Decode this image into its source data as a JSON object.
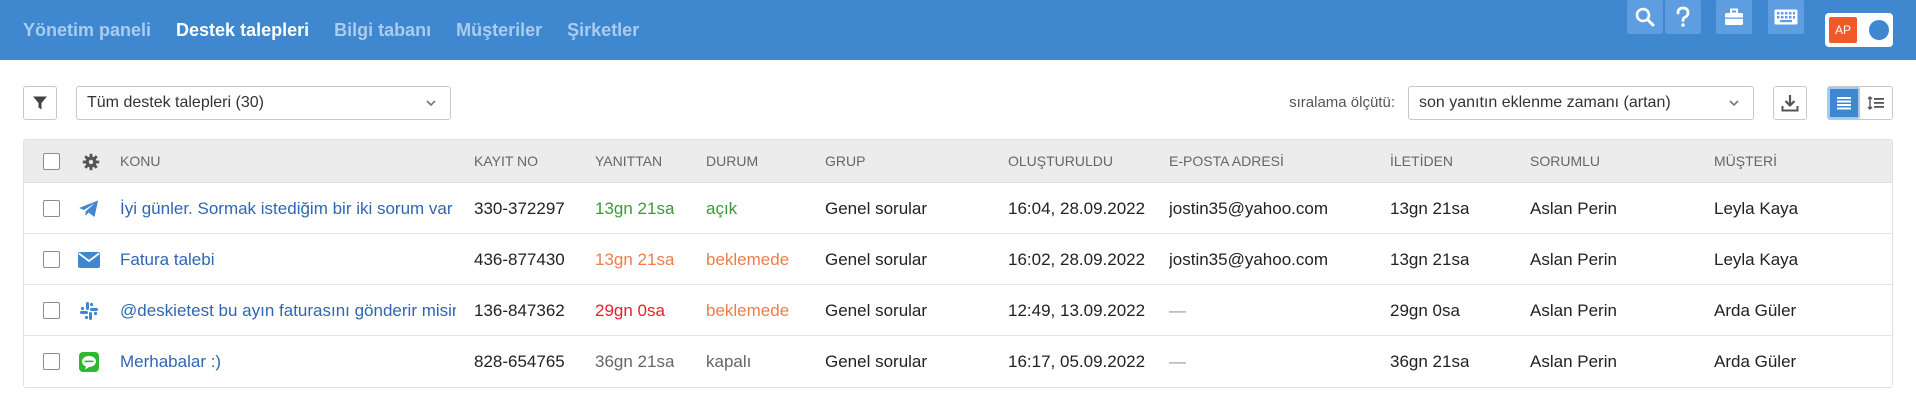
{
  "nav": {
    "items": [
      {
        "label": "Yönetim paneli",
        "active": false
      },
      {
        "label": "Destek talepleri",
        "active": true
      },
      {
        "label": "Bilgi tabanı",
        "active": false
      },
      {
        "label": "Müşteriler",
        "active": false
      },
      {
        "label": "Şirketler",
        "active": false
      }
    ]
  },
  "top_icons": [
    "search-icon",
    "help-icon",
    "briefcase-icon",
    "keyboard-icon"
  ],
  "user": {
    "initials": "AP"
  },
  "filter": {
    "selected": "Tüm destek talepleri (30)"
  },
  "sort": {
    "label": "sıralama ölçütü:",
    "selected": "son yanıtın eklenme zamanı (artan)"
  },
  "table": {
    "headers": {
      "subject": "KONU",
      "id": "KAYIT NO",
      "since_reply": "YANITTAN",
      "status": "DURUM",
      "group": "GRUP",
      "created": "OLUŞTURULDU",
      "email": "E-POSTA ADRESİ",
      "since_message": "İLETİDEN",
      "assignee": "SORUMLU",
      "customer": "MÜŞTERİ"
    },
    "rows": [
      {
        "channel": "telegram-icon",
        "subject": "İyi günler. Sormak istediğim bir iki sorum var",
        "id": "330-372297",
        "since_reply": "13gn 21sa",
        "status": "açık",
        "group": "Genel sorular",
        "created": "16:04, 28.09.2022",
        "email": "jostin35@yahoo.com",
        "since_message": "13gn 21sa",
        "assignee": "Aslan Perin",
        "customer": "Leyla Kaya"
      },
      {
        "channel": "email-icon",
        "subject": "Fatura talebi",
        "id": "436-877430",
        "since_reply": "13gn 21sa",
        "status": "beklemede",
        "group": "Genel sorular",
        "created": "16:02, 28.09.2022",
        "email": "jostin35@yahoo.com",
        "since_message": "13gn 21sa",
        "assignee": "Aslan Perin",
        "customer": "Leyla Kaya"
      },
      {
        "channel": "slack-icon",
        "subject": "@deskietest bu ayın faturasını gönderir misiniz",
        "id": "136-847362",
        "since_reply": "29gn 0sa",
        "status": "beklemede",
        "group": "Genel sorular",
        "created": "12:49, 13.09.2022",
        "email": "—",
        "since_message": "29gn 0sa",
        "assignee": "Aslan Perin",
        "customer": "Arda Güler"
      },
      {
        "channel": "line-icon",
        "subject": "Merhabalar :)",
        "id": "828-654765",
        "since_reply": "36gn 21sa",
        "status": "kapalı",
        "group": "Genel sorular",
        "created": "16:17, 05.09.2022",
        "email": "—",
        "since_message": "36gn 21sa",
        "assignee": "Aslan Perin",
        "customer": "Arda Güler"
      }
    ]
  },
  "colors": {
    "topbar": "#3f87cf",
    "link": "#2f66b3",
    "status_open": "#3a9a3a",
    "status_pending": "#ef7d4b",
    "status_closed": "#666666",
    "since_green": "#3a9a3a",
    "since_orange": "#ef7d4b",
    "since_red": "#e5202b",
    "since_gray": "#666666"
  }
}
